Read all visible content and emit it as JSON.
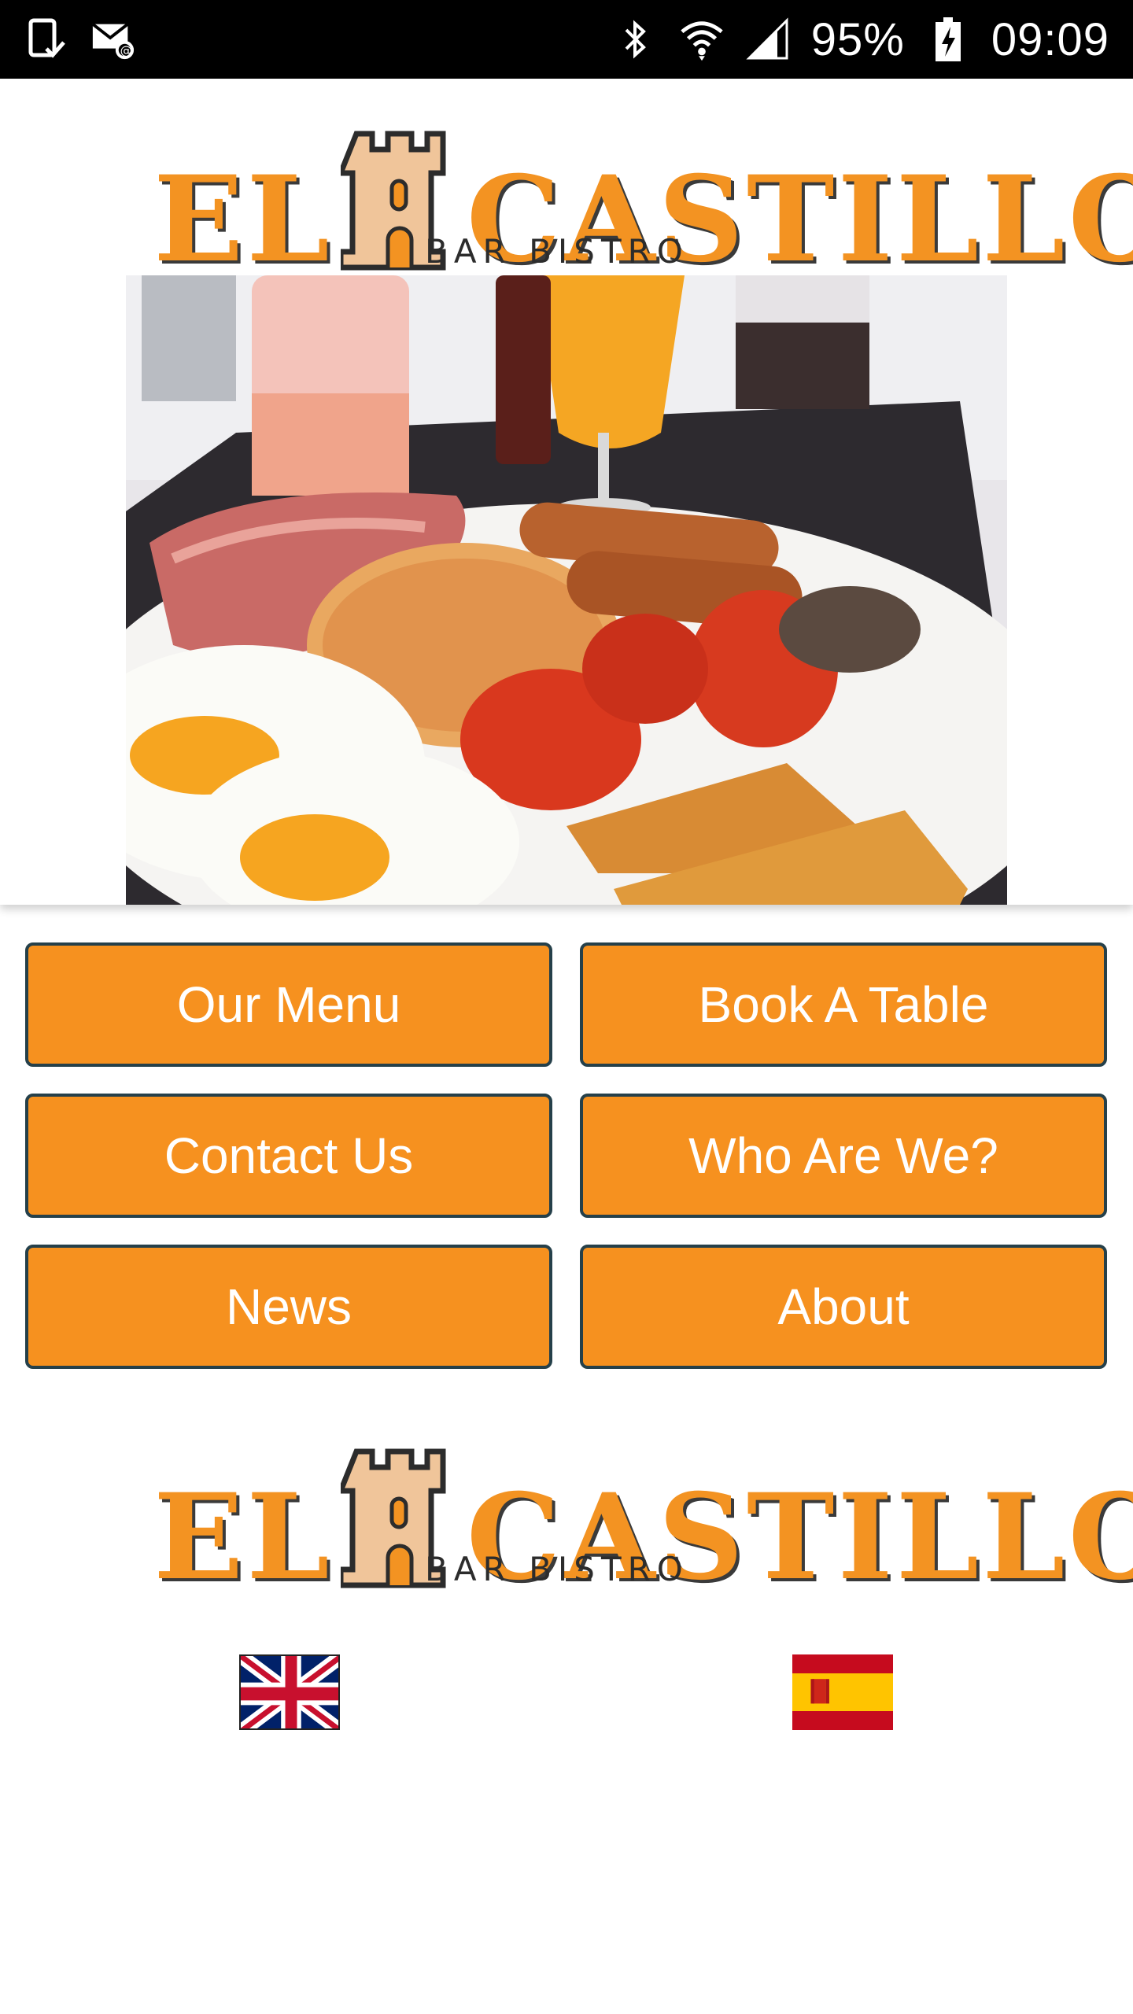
{
  "status_bar": {
    "battery": "95%",
    "time": "09:09",
    "icons": [
      "screenshot-icon",
      "email-icon",
      "bluetooth-icon",
      "wifi-icon",
      "signal-icon",
      "battery-icon"
    ]
  },
  "brand": {
    "name_part1": "EL",
    "name_part2": "CASTILLO",
    "subtitle": "BAR BISTRO",
    "color": "#f39322"
  },
  "menu": {
    "buttons": [
      {
        "label": "Our Menu"
      },
      {
        "label": "Book A Table"
      },
      {
        "label": "Contact Us"
      },
      {
        "label": "Who Are We?"
      },
      {
        "label": "News"
      },
      {
        "label": "About"
      }
    ],
    "button_color": "#f6911f",
    "border_color": "#25404a"
  },
  "languages": [
    {
      "name": "uk-flag-icon"
    },
    {
      "name": "spain-flag-icon"
    }
  ]
}
